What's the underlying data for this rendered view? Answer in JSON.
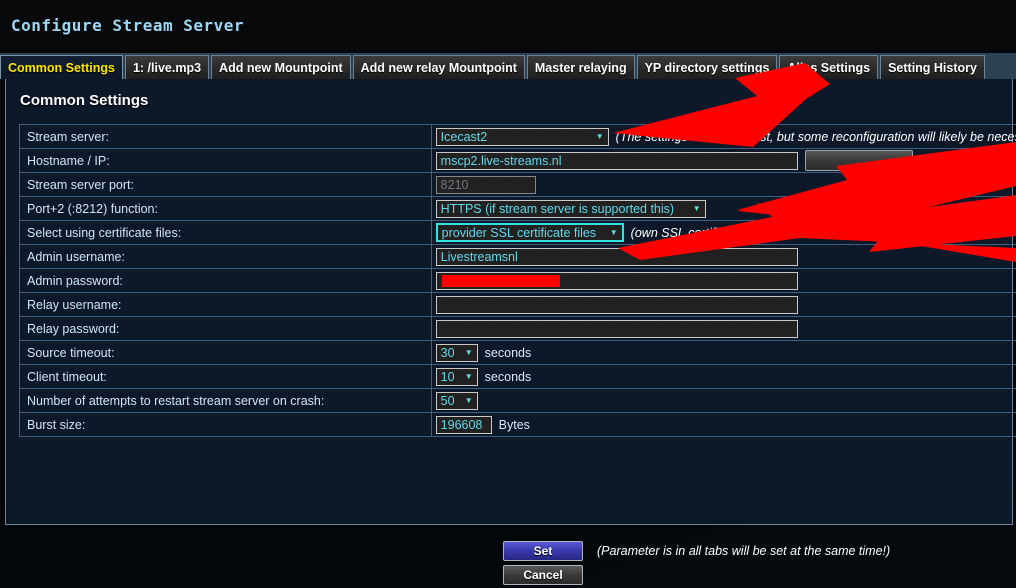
{
  "window": {
    "title": "Configure Stream Server"
  },
  "tabs": [
    {
      "label": "Common Settings",
      "active": true
    },
    {
      "label": "1: /live.mp3",
      "active": false
    },
    {
      "label": "Add new Mountpoint",
      "active": false
    },
    {
      "label": "Add new relay Mountpoint",
      "active": false
    },
    {
      "label": "Master relaying",
      "active": false
    },
    {
      "label": "YP directory settings",
      "active": false
    },
    {
      "label": "Alias Settings",
      "active": false
    },
    {
      "label": "Setting History",
      "active": false
    }
  ],
  "panel": {
    "heading": "Common Settings",
    "rows": {
      "stream_server": {
        "label": "Stream server:",
        "value": "Icecast2",
        "hint": "(The settings will not be lost, but some reconfiguration will likely be necess"
      },
      "hostname": {
        "label": "Hostname / IP:",
        "value": "mscp2.live-streams.nl"
      },
      "port": {
        "label": "Stream server port:",
        "value": "8210"
      },
      "port2": {
        "label": "Port+2 (:8212) function:",
        "value": "HTTPS (if stream server is supported this)"
      },
      "cert": {
        "label": "Select using certificate files:",
        "value": "provider SSL certificate files",
        "hint": "(own SSL certificate files location: ~/server/certs/ ; files: certificate.ke"
      },
      "admin_user": {
        "label": "Admin username:",
        "value": "Livestreamsnl"
      },
      "admin_pass": {
        "label": "Admin password:",
        "value": ""
      },
      "relay_user": {
        "label": "Relay username:",
        "value": ""
      },
      "relay_pass": {
        "label": "Relay password:",
        "value": ""
      },
      "source_timeout": {
        "label": "Source timeout:",
        "value": "30",
        "unit": "seconds"
      },
      "client_timeout": {
        "label": "Client timeout:",
        "value": "10",
        "unit": "seconds"
      },
      "restart_attempts": {
        "label": "Number of attempts to restart stream server on crash:",
        "value": "50"
      },
      "burst_size": {
        "label": "Burst size:",
        "value": "196608",
        "unit": "Bytes"
      }
    }
  },
  "footer": {
    "set_label": "Set",
    "cancel_label": "Cancel",
    "note": "(Parameter is in all tabs will be set at the same time!)"
  },
  "colors": {
    "accent_cyan": "#63d8e8",
    "active_tab_text": "#ffe400",
    "annotation_red": "#ff0000",
    "panel_bg": "#0d1829",
    "tabstrip_bg": "#2a4254"
  }
}
